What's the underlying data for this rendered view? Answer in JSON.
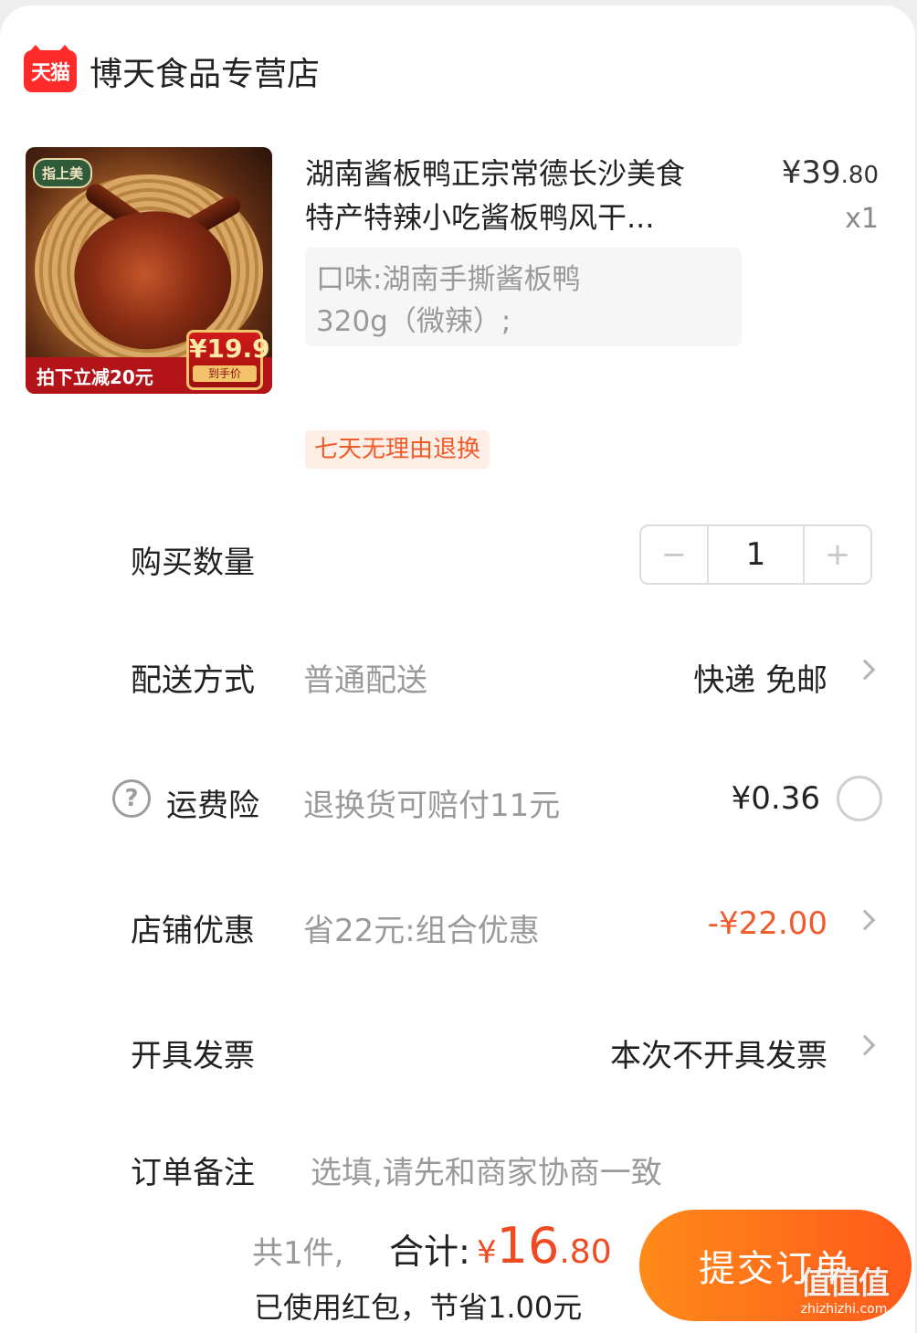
{
  "shop": {
    "logo_text": "天猫",
    "name": "博天食品专营店"
  },
  "product": {
    "title_line1": "湖南酱板鸭正宗常德长沙美食",
    "title_line2": "特产特辣小吃酱板鸭风干...",
    "price_symbol": "¥",
    "price_int": "39",
    "price_cents": ".80",
    "quantity_label": "x1",
    "sku_line1": "口味:湖南手撕酱板鸭",
    "sku_line2": "320g（微辣）;",
    "return_tag": "七天无理由退换",
    "thumb": {
      "brand": "指上美",
      "promo": "拍下立减20元",
      "badge_price": "¥19.9",
      "badge_label": "到手价"
    }
  },
  "rows": {
    "quantity": {
      "label": "购买数量",
      "minus": "−",
      "value": "1",
      "plus": "+"
    },
    "delivery": {
      "label": "配送方式",
      "sub": "普通配送",
      "value": "快递 免邮"
    },
    "insurance": {
      "label": "运费险",
      "help": "?",
      "sub": "退换货可赔付11元",
      "value": "¥0.36"
    },
    "discount": {
      "label": "店铺优惠",
      "sub": "省22元:组合优惠",
      "value": "-¥22.00",
      "value_color": "#ef5b2a"
    },
    "invoice": {
      "label": "开具发票",
      "value": "本次不开具发票"
    },
    "note": {
      "label": "订单备注",
      "placeholder": "选填,请先和商家协商一致"
    }
  },
  "footer": {
    "count": "共1件,",
    "total_label": "合计:",
    "total_symbol": "¥",
    "total_int": "16",
    "total_cents": ".80",
    "savings": "已使用红包，节省1.00元",
    "submit": "提交订单"
  },
  "watermark": {
    "logo": "值值值",
    "url": "zhizhizhi.com"
  },
  "colors": {
    "accent": "#ef4a22",
    "button_start": "#ff8a1a",
    "button_end": "#ff5a1a"
  }
}
